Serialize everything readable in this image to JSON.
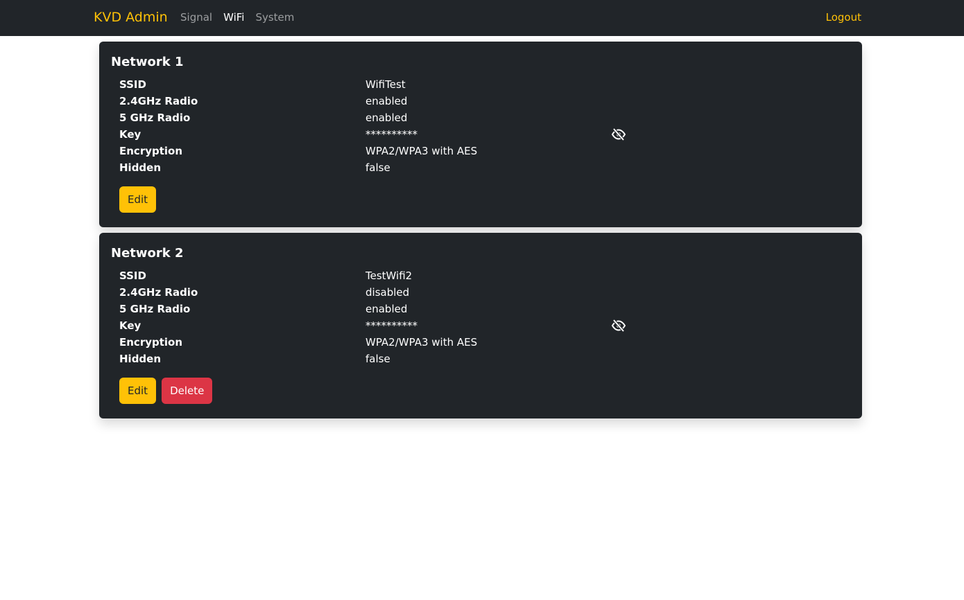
{
  "nav": {
    "brand": "KVD Admin",
    "links": [
      "Signal",
      "WiFi",
      "System"
    ],
    "active": "WiFi",
    "logout": "Logout"
  },
  "labels": {
    "ssid": "SSID",
    "radio24": "2.4GHz Radio",
    "radio5": "5 GHz Radio",
    "key": "Key",
    "encryption": "Encryption",
    "hidden": "Hidden"
  },
  "networks": [
    {
      "title": "Network 1",
      "ssid": "WifiTest",
      "radio24": "enabled",
      "radio5": "enabled",
      "key": "**********",
      "encryption": "WPA2/WPA3 with AES",
      "hidden": "false",
      "edit_label": "Edit"
    },
    {
      "title": "Network 2",
      "ssid": "TestWifi2",
      "radio24": "disabled",
      "radio5": "enabled",
      "key": "**********",
      "encryption": "WPA2/WPA3 with AES",
      "hidden": "false",
      "edit_label": "Edit",
      "delete_label": "Delete"
    }
  ],
  "icons": {
    "key_toggle": "eye-slash-icon"
  },
  "colors": {
    "navbar": "#212529",
    "card": "#212529",
    "accent": "#ffc107",
    "danger": "#dc3545"
  }
}
